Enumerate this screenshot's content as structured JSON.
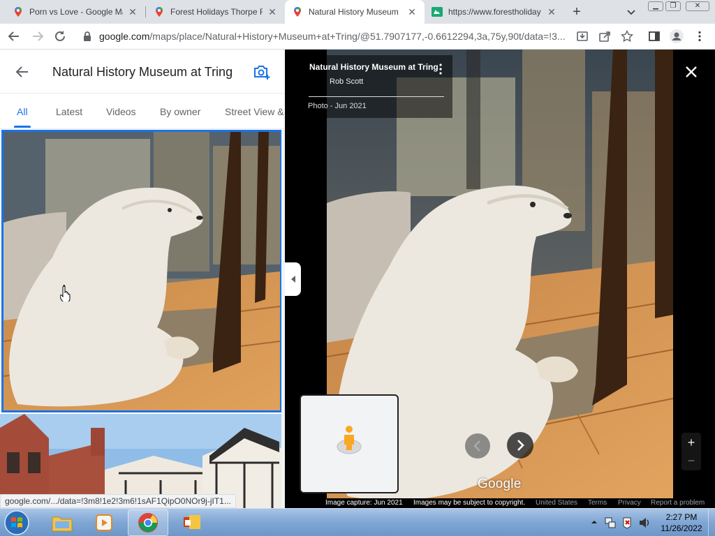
{
  "browser": {
    "tabs": [
      {
        "title": "Porn vs Love - Google Ma",
        "icon": "maps-pin-icon",
        "active": false
      },
      {
        "title": "Forest Holidays Thorpe Fo",
        "icon": "maps-pin-icon",
        "active": false
      },
      {
        "title": "Natural History Museum",
        "icon": "maps-pin-icon",
        "active": true
      },
      {
        "title": "https://www.forestholiday",
        "icon": "forest-holidays-icon",
        "active": false
      }
    ],
    "new_tab_label": "+",
    "address_host": "google.com",
    "address_path": "/maps/place/Natural+History+Museum+at+Tring/@51.7907177,-0.6612294,3a,75y,90t/data=!3..."
  },
  "panel": {
    "title": "Natural History Museum at Tring",
    "tabs": [
      {
        "label": "All",
        "active": true
      },
      {
        "label": "Latest",
        "active": false
      },
      {
        "label": "Videos",
        "active": false
      },
      {
        "label": "By owner",
        "active": false
      },
      {
        "label": "Street View &",
        "active": false
      }
    ],
    "status_url": "google.com/.../data=!3m8!1e2!3m6!1sAF1QipO0NOr9j-jIT1..."
  },
  "viewer": {
    "place_name": "Natural History Museum at Tring",
    "author": "Rob Scott",
    "photo_date": "Photo - Jun 2021",
    "watermark": "Google",
    "zoom_in": "+",
    "zoom_out": "−",
    "footer": {
      "capture": "Image capture: Jun 2021",
      "copyright": "Images may be subject to copyright.",
      "country": "United States",
      "terms": "Terms",
      "privacy": "Privacy",
      "report": "Report a problem"
    }
  },
  "taskbar": {
    "time": "2:27 PM",
    "date": "11/26/2022"
  },
  "colors": {
    "accent": "#1a73e8",
    "tabstrip": "#dee1e6",
    "taskbar": "#7fa6d4"
  }
}
